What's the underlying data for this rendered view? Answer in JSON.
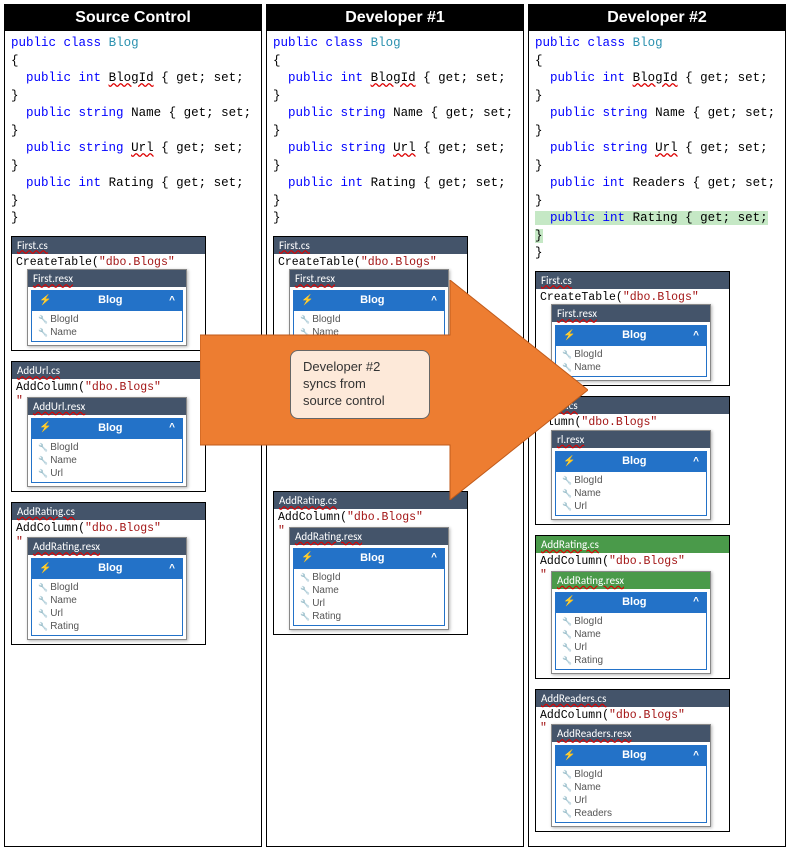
{
  "columns": [
    {
      "title": "Source Control"
    },
    {
      "title": "Developer #1"
    },
    {
      "title": "Developer #2"
    }
  ],
  "code": {
    "public": "public",
    "class": "class",
    "int": "int",
    "string": "string",
    "blog": "Blog",
    "blogid": "BlogId",
    "name": "Name",
    "url": "Url",
    "rating": "Rating",
    "readers": "Readers",
    "getset": "{ get; set; }",
    "open": "{",
    "close": "}"
  },
  "files": {
    "first_cs": "First.cs",
    "first_resx": "First.resx",
    "addurl_cs": "AddUrl.cs",
    "addurl_resx": "AddUrl.resx",
    "url_resx": "rl.resx",
    "addurl_cs_short": "ddUrl.cs",
    "addrating_cs": "AddRating.cs",
    "addrating_resx": "AddRating.resx",
    "addreaders_cs": "AddReaders.cs",
    "addreaders_resx": "AddReaders.resx",
    "createtable": "CreateTable(",
    "addcolumn": "AddColumn(",
    "olumn": "olumn(",
    "dboblogs": "\"dbo.Blogs\"",
    "quote": "\""
  },
  "blog": {
    "title": "Blog",
    "blogid": "BlogId",
    "name": "Name",
    "url": "Url",
    "rating": "Rating",
    "readers": "Readers"
  },
  "callout": {
    "line1": "Developer #2",
    "line2": "syncs from",
    "line3": "source control"
  }
}
